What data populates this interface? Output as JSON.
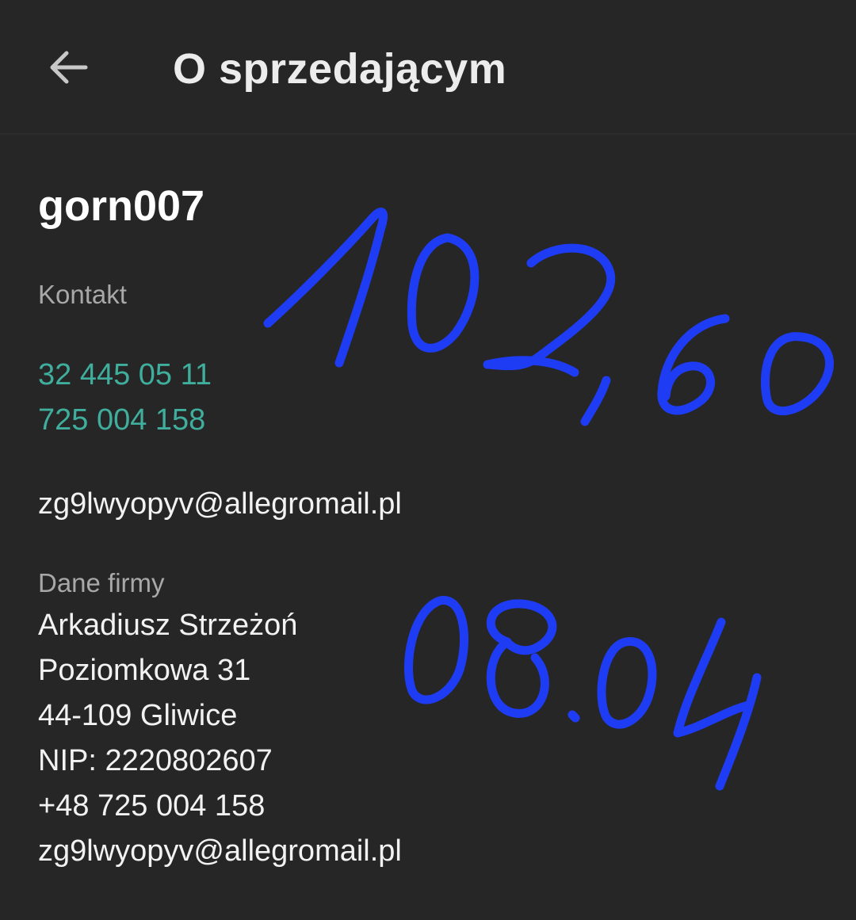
{
  "app_bar": {
    "title": "O sprzedającym",
    "back_icon": "arrow-left-icon"
  },
  "seller": {
    "name": "gorn007"
  },
  "contact": {
    "label": "Kontakt",
    "phones": [
      "32 445 05 11",
      "725 004 158"
    ],
    "email": "zg9lwyopyv@allegromail.pl"
  },
  "company": {
    "label": "Dane firmy",
    "lines": [
      "Arkadiusz Strzeżoń",
      "Poziomkowa 31",
      "44-109 Gliwice",
      "NIP: 2220802607",
      "+48 725 004 158",
      "zg9lwyopyv@allegromail.pl"
    ]
  },
  "handwritten_annotations": {
    "color": "#1f3cf5",
    "amount": "102,60",
    "date": "08.04"
  },
  "colors": {
    "background": "#262626",
    "link": "#3fae9c",
    "label": "#a8a8a8"
  }
}
